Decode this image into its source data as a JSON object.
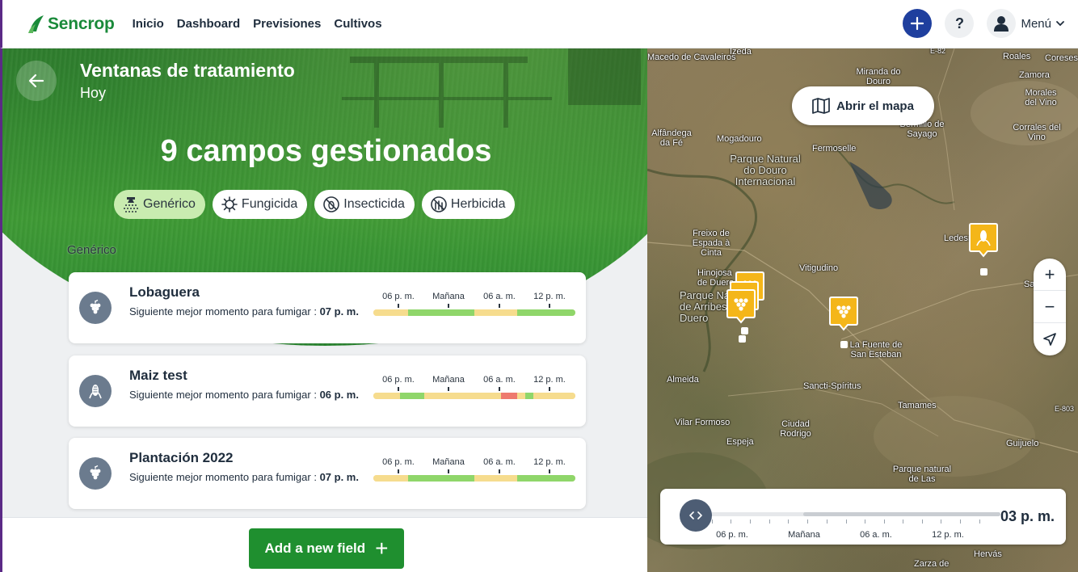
{
  "nav": {
    "brand": "Sencrop",
    "links": [
      "Inicio",
      "Dashboard",
      "Previsiones",
      "Cultivos"
    ],
    "help_label": "?",
    "menu_label": "Menú"
  },
  "panel": {
    "title": "Ventanas de tratamiento",
    "subtitle": "Hoy",
    "headline": "9 campos gestionados",
    "filters": [
      {
        "label": "Genérico",
        "icon": "sprayer-icon",
        "active": true
      },
      {
        "label": "Fungicida",
        "icon": "virus-icon",
        "active": false
      },
      {
        "label": "Insecticida",
        "icon": "no-bug-icon",
        "active": false
      },
      {
        "label": "Herbicida",
        "icon": "no-weed-icon",
        "active": false
      }
    ],
    "section_label": "Genérico",
    "timeline_labels": [
      "06 p. m.",
      "Mañana",
      "06 a. m.",
      "12 p. m."
    ],
    "fields": [
      {
        "name": "Lobaguera",
        "desc_prefix": "Siguiente mejor momento para fumigar : ",
        "desc_time": "07 p. m.",
        "icon": "grape-icon",
        "timeline": [
          [
            "yellow",
            0,
            0.17
          ],
          [
            "green",
            0.17,
            0.5
          ],
          [
            "yellow",
            0.5,
            0.71
          ],
          [
            "green",
            0.71,
            1.0
          ]
        ]
      },
      {
        "name": "Maiz test",
        "desc_prefix": "Siguiente mejor momento para fumigar : ",
        "desc_time": "06 p. m.",
        "icon": "corn-icon",
        "timeline": [
          [
            "yellow",
            0,
            0.13
          ],
          [
            "green",
            0.13,
            0.25
          ],
          [
            "yellow",
            0.25,
            0.63
          ],
          [
            "red",
            0.63,
            0.71
          ],
          [
            "yellow",
            0.71,
            0.75
          ],
          [
            "green",
            0.75,
            0.79
          ],
          [
            "yellow",
            0.79,
            1.0
          ]
        ]
      },
      {
        "name": "Plantación 2022",
        "desc_prefix": "Siguiente mejor momento para fumigar : ",
        "desc_time": "07 p. m.",
        "icon": "grape-icon",
        "timeline": [
          [
            "yellow",
            0,
            0.17
          ],
          [
            "green",
            0.17,
            0.5
          ],
          [
            "yellow",
            0.5,
            0.71
          ],
          [
            "green",
            0.71,
            1.0
          ]
        ]
      }
    ],
    "add_button": "Add a new field"
  },
  "map": {
    "open_map": "Abrir el mapa",
    "zoom_in": "+",
    "zoom_out": "−",
    "slider_labels": [
      "06 p. m.",
      "Mañana",
      "06 a. m.",
      "12 p. m."
    ],
    "slider_time": "03 p. m.",
    "labels": [
      "Macedo de Cavaleiros",
      "Izeda",
      "E-82",
      "Miranda do Douro",
      "Roales",
      "Coreses",
      "Zamora",
      "Morales del Vino",
      "Bermillo de Sayago",
      "Corrales del Vino",
      "Alfândega da Fé",
      "Mogadouro",
      "Fermoselle",
      "Parque Natural do Douro Internacional",
      "Ledesma",
      "Freixo de Espada à Cinta",
      "Vitigudino",
      "Hinojosa de Duero",
      "Parque Natural de Arribes del Duero",
      "La Fuente de San Esteban",
      "Sa",
      "Almeida",
      "Sancti-Spíritus",
      "Tamames",
      "E-803",
      "Vilar Formoso",
      "Ciudad Rodrigo",
      "Espeja",
      "Guijuelo",
      "Parque natural de Las",
      "Hervás",
      "Zarza de"
    ]
  },
  "colors": {
    "brand_green": "#1a8a3a",
    "nav_plus": "#1f3f9e",
    "chip_active": "#c9ecb0",
    "tl_yellow": "#f6dc8e",
    "tl_green": "#8fd66a",
    "tl_red": "#ee7a6e",
    "add_button": "#1f8f2f",
    "marker": "#f4b619"
  }
}
